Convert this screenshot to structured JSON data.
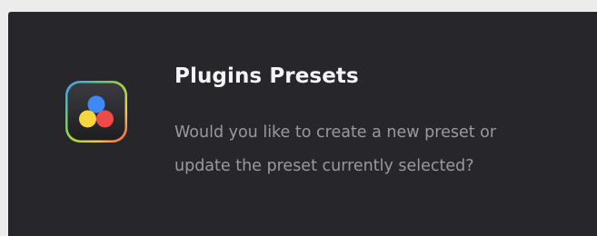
{
  "dialog": {
    "title": "Plugins Presets",
    "message_lines": [
      "Would you like to create a new preset or",
      "update the preset currently selected?"
    ],
    "icon": "davinci-resolve-app-icon"
  },
  "colors": {
    "dialog_background": "#27272b",
    "title_text": "#f4f4f4",
    "message_text": "#9a9a9e",
    "icon_blue": "#3d8af7",
    "icon_yellow": "#f5d63d",
    "icon_red": "#ef4a4a"
  }
}
